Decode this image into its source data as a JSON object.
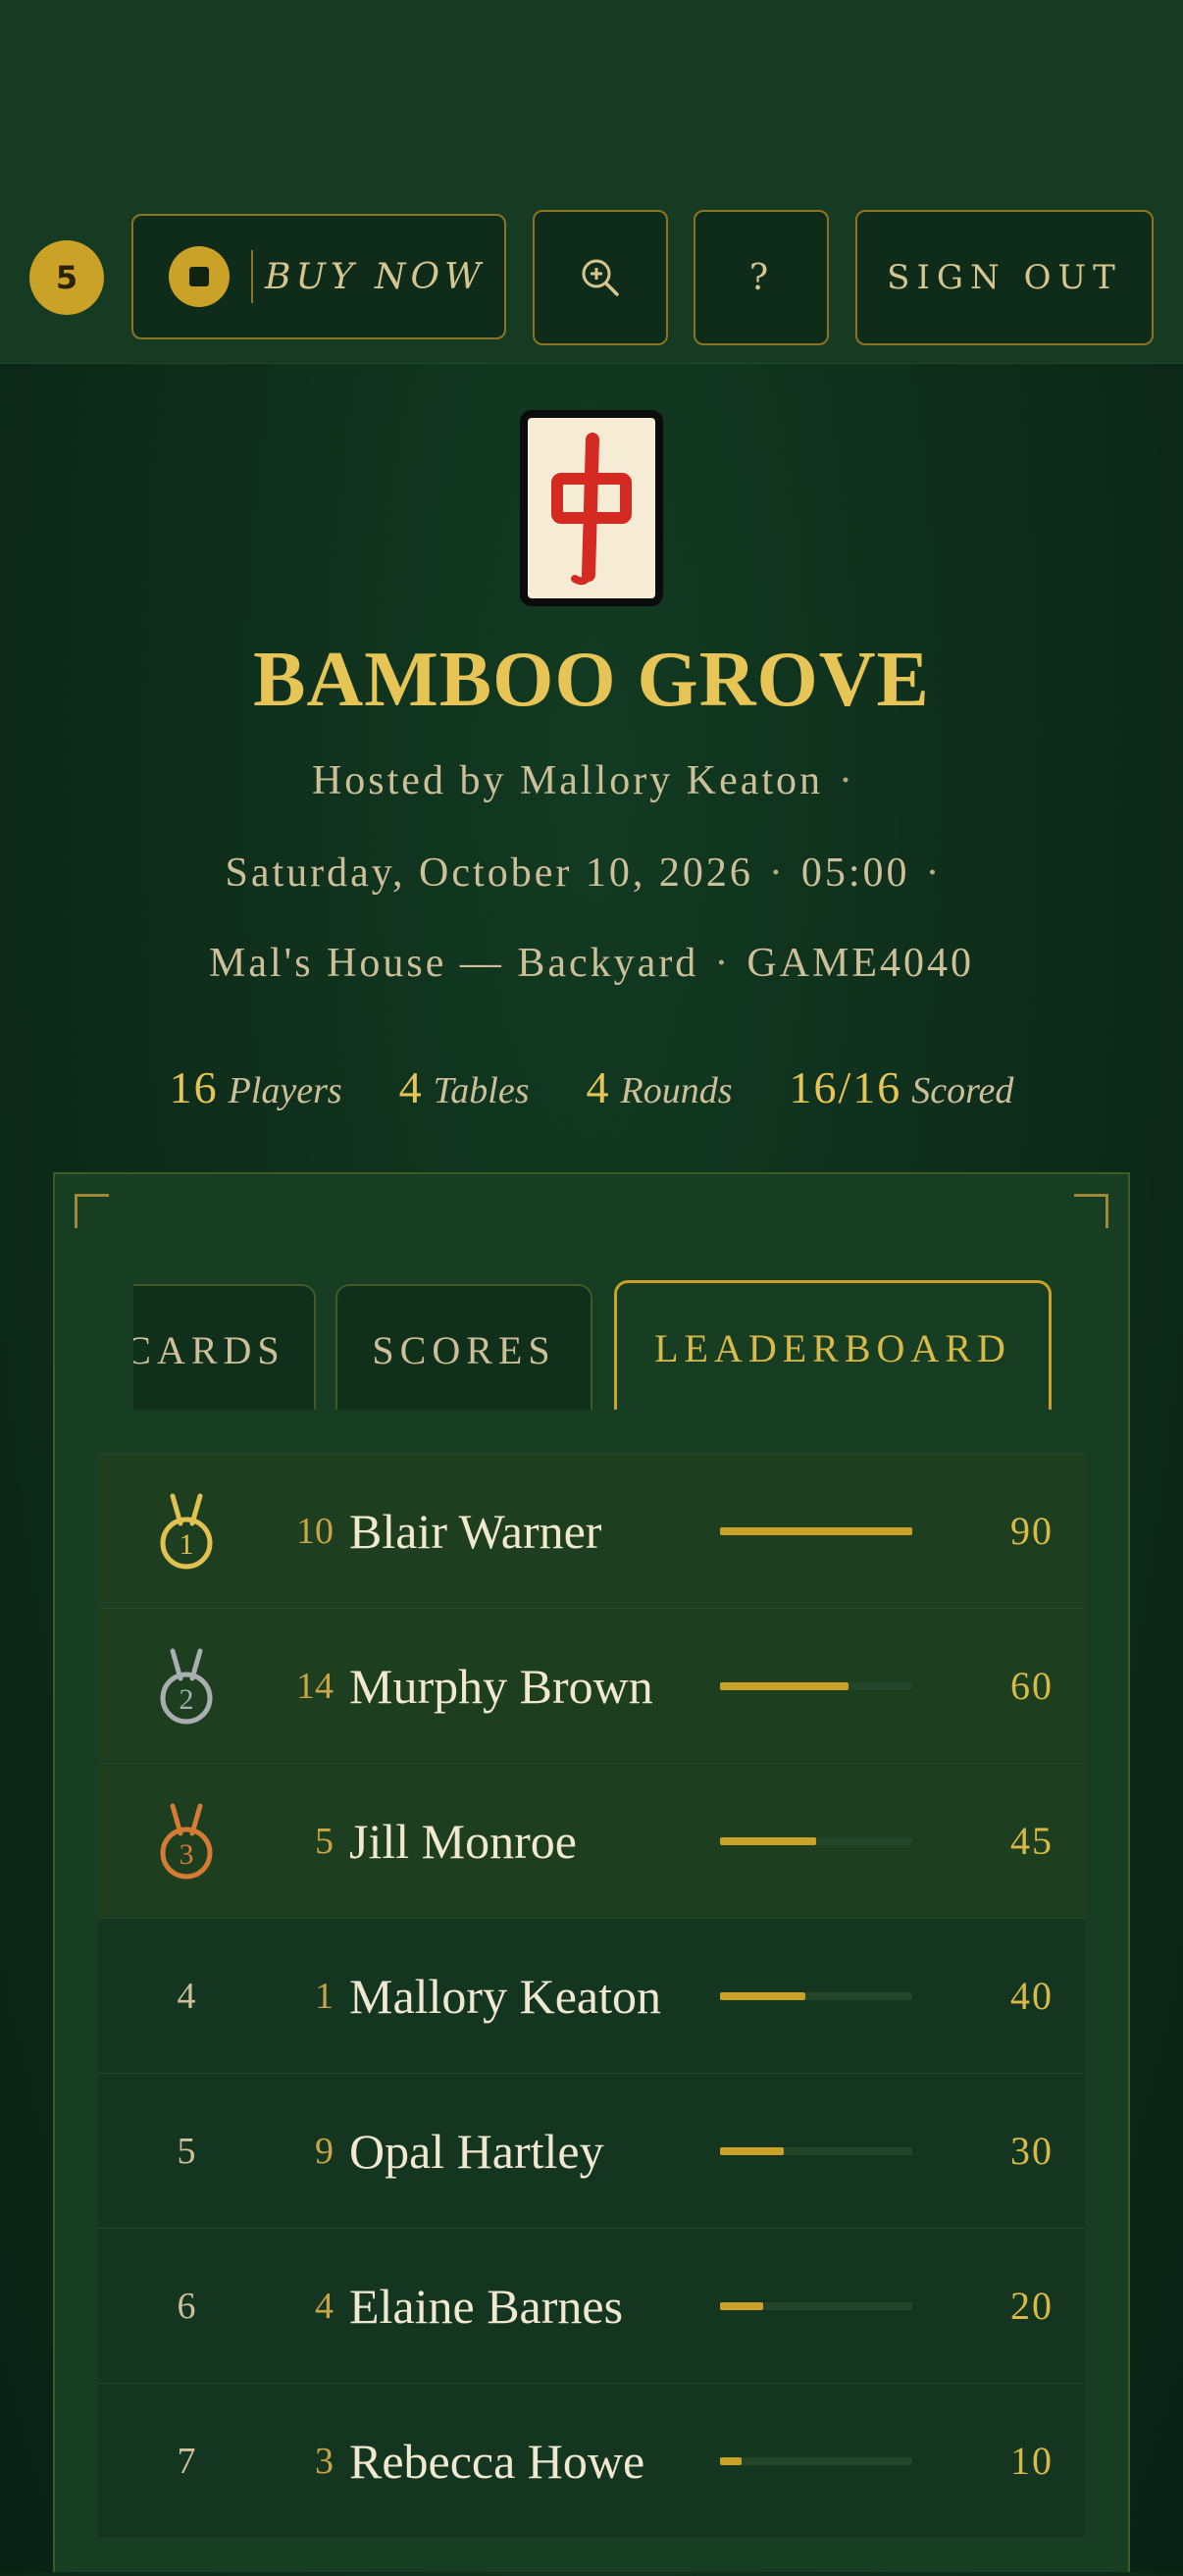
{
  "topbar": {
    "badge_count": "5",
    "buy_label": "BUY NOW",
    "zoom_icon": "zoom-in-icon",
    "help_label": "?",
    "signout_label": "SIGN OUT"
  },
  "header": {
    "tile_icon": "red-dragon-mahjong-tile",
    "title": "BAMBOO GROVE",
    "host": "Hosted by Mallory Keaton",
    "date": "Saturday, October 10, 2026",
    "time": "05:00",
    "location": "Mal's House — Backyard",
    "game_code": "GAME4040",
    "separator": "·"
  },
  "stats": {
    "players_value": "16",
    "players_label": "Players",
    "tables_value": "4",
    "tables_label": "Tables",
    "rounds_value": "4",
    "rounds_label": "Rounds",
    "scored_value": "16/16",
    "scored_label": "Scored"
  },
  "tabs": [
    {
      "label": "CARDS",
      "active": false
    },
    {
      "label": "SCORES",
      "active": false
    },
    {
      "label": "LEADERBOARD",
      "active": true
    }
  ],
  "leaderboard": [
    {
      "rank": "1",
      "medal": "gold",
      "seat": "10",
      "name": "Blair Warner",
      "score": "90",
      "fraction": 1.0
    },
    {
      "rank": "2",
      "medal": "silver",
      "seat": "14",
      "name": "Murphy Brown",
      "score": "60",
      "fraction": 0.667
    },
    {
      "rank": "3",
      "medal": "bronze",
      "seat": "5",
      "name": "Jill Monroe",
      "score": "45",
      "fraction": 0.5
    },
    {
      "rank": "4",
      "medal": "",
      "seat": "1",
      "name": "Mallory Keaton",
      "score": "40",
      "fraction": 0.444
    },
    {
      "rank": "5",
      "medal": "",
      "seat": "9",
      "name": "Opal Hartley",
      "score": "30",
      "fraction": 0.333
    },
    {
      "rank": "6",
      "medal": "",
      "seat": "4",
      "name": "Elaine Barnes",
      "score": "20",
      "fraction": 0.222
    },
    {
      "rank": "7",
      "medal": "",
      "seat": "3",
      "name": "Rebecca Howe",
      "score": "10",
      "fraction": 0.111
    }
  ],
  "colors": {
    "accent_gold": "#c9a227",
    "medal_gold": "#e1c14f",
    "medal_silver": "#a9aeb0",
    "medal_bronze": "#d57b35",
    "tile_red": "#d42a22"
  }
}
